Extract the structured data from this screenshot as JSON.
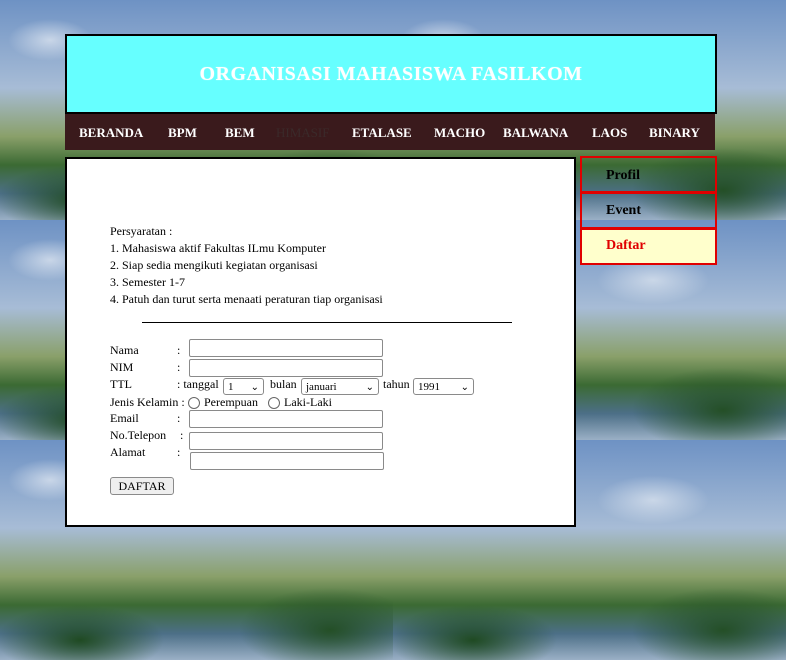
{
  "header": {
    "title": "ORGANISASI MAHASISWA FASILKOM"
  },
  "nav": {
    "items": [
      "BERANDA",
      "BPM",
      "BEM",
      "HIMASIF",
      "ETALASE",
      "MACHO",
      "BALWANA",
      "LAOS",
      "BINARY"
    ]
  },
  "requirements": {
    "title": "Persyaratan :",
    "items": [
      "1. Mahasiswa aktif Fakultas ILmu Komputer",
      "2. Siap sedia mengikuti kegiatan organisasi",
      "3. Semester 1-7",
      "4. Patuh dan turut serta menaati peraturan tiap organisasi"
    ]
  },
  "form": {
    "nama_label": "Nama",
    "nim_label": "NIM",
    "ttl_label": "TTL",
    "tanggal_label": ": tanggal",
    "tanggal_value": "1",
    "bulan_label": "bulan",
    "bulan_value": "januari",
    "tahun_label": "tahun",
    "tahun_value": "1991",
    "jenis_label": "Jenis Kelamin :",
    "perempuan_label": "Perempuan",
    "laki_label": "Laki-Laki",
    "email_label": "Email",
    "telp_label": "No.Telepon",
    "alamat_label": "Alamat",
    "colon": ":",
    "submit_label": "DAFTAR"
  },
  "sidebar": {
    "profil": "Profil",
    "event": "Event",
    "daftar": "Daftar"
  },
  "colors": {
    "header_bg": "#66ffff",
    "nav_bg": "#3a1a1c",
    "sidebar_border": "#e00000",
    "daftar_bg": "#ffffcc"
  }
}
